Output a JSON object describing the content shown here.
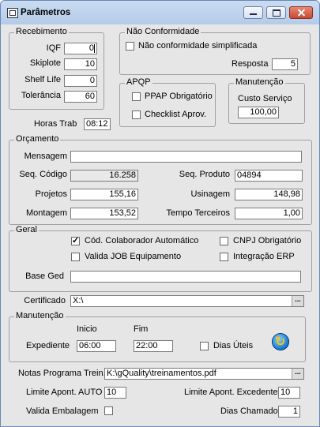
{
  "window": {
    "title": "Parâmetros"
  },
  "recebimento": {
    "legend": "Recebimento",
    "iqf_label": "IQF",
    "iqf_value": "0",
    "skiplote_label": "Skiplote",
    "skiplote_value": "10",
    "shelflife_label": "Shelf Life",
    "shelflife_value": "0",
    "tolerancia_label": "Tolerância",
    "tolerancia_value": "60"
  },
  "nao_conformidade": {
    "legend": "Não Conformidade",
    "simplificada_label": "Não conformidade simplificada",
    "resposta_label": "Resposta",
    "resposta_value": "5"
  },
  "apqp": {
    "legend": "APQP",
    "ppap_label": "PPAP Obrigatório",
    "checklist_label": "Checklist Aprov."
  },
  "manutencao_top": {
    "legend": "Manutenção",
    "custo_label": "Custo Serviço",
    "custo_value": "100,00"
  },
  "horas_trab": {
    "label": "Horas Trab",
    "value": "08:12"
  },
  "orcamento": {
    "legend": "Orçamento",
    "mensagem_label": "Mensagem",
    "mensagem_value": "",
    "seq_codigo_label": "Seq. Código",
    "seq_codigo_value": "16.258",
    "seq_produto_label": "Seq. Produto",
    "seq_produto_value": "04894",
    "projetos_label": "Projetos",
    "projetos_value": "155,16",
    "usinagem_label": "Usinagem",
    "usinagem_value": "148,98",
    "montagem_label": "Montagem",
    "montagem_value": "153,52",
    "tempo_terceiros_label": "Tempo Terceiros",
    "tempo_terceiros_value": "1,00"
  },
  "geral": {
    "legend": "Geral",
    "cod_colab_label": "Cód. Colaborador Automático",
    "cnpj_label": "CNPJ Obrigatório",
    "valida_job_label": "Valida JOB Equipamento",
    "integracao_label": "Integração ERP",
    "base_ged_label": "Base Ged",
    "base_ged_value": ""
  },
  "certificado": {
    "label": "Certificado",
    "value": "X:\\",
    "browse": "..."
  },
  "manutencao": {
    "legend": "Manutenção",
    "inicio_label": "Inicio",
    "fim_label": "Fim",
    "expediente_label": "Expediente",
    "inicio_value": "06:00",
    "fim_value": "22:00",
    "dias_uteis_label": "Dias Úteis"
  },
  "notas": {
    "label": "Notas Programa Trein.",
    "value": "K:\\gQuality\\treinamentos.pdf",
    "browse": "..."
  },
  "limites": {
    "auto_label": "Limite Apont. AUTO",
    "auto_value": "10",
    "excedente_label": "Limite Apont. Excedente",
    "excedente_value": "10",
    "valida_embalagem_label": "Valida Embalagem",
    "dias_chamado_label": "Dias Chamado",
    "dias_chamado_value": "1"
  }
}
